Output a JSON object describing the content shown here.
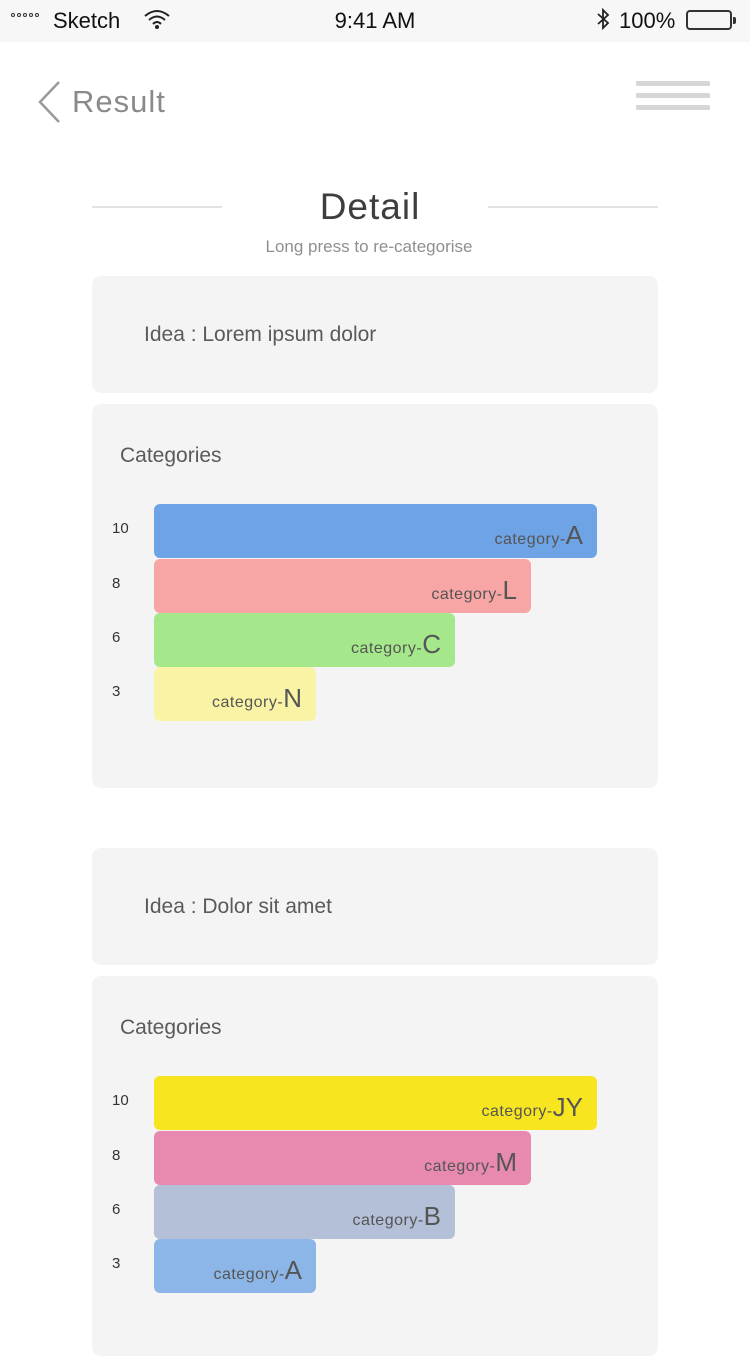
{
  "status_bar": {
    "carrier": "Sketch",
    "time": "9:41 AM",
    "battery": "100%",
    "icons": [
      "signal-icon",
      "wifi-icon",
      "bluetooth-icon",
      "battery-icon"
    ]
  },
  "nav": {
    "back_label": "Result",
    "back_icon": "chevron-left-icon",
    "menu_icon": "hamburger-menu-icon"
  },
  "header": {
    "title": "Detail",
    "subtitle": "Long press to re-categorise"
  },
  "ideas": [
    {
      "idea_text": "Idea : Lorem ipsum dolor",
      "categories_title": "Categories",
      "categories": [
        {
          "score": "10",
          "prefix": "category-",
          "code": "A",
          "value": 10,
          "color": "#6ea3e6"
        },
        {
          "score": "8",
          "prefix": "category-",
          "code": "L",
          "value": 8,
          "color": "#f8a5a5"
        },
        {
          "score": "6",
          "prefix": "category-",
          "code": "C",
          "value": 6,
          "color": "#a5e88b"
        },
        {
          "score": "3",
          "prefix": "category-",
          "code": "N",
          "value": 3,
          "color": "#f9f4a5"
        }
      ]
    },
    {
      "idea_text": "Idea : Dolor sit amet",
      "categories_title": "Categories",
      "categories": [
        {
          "score": "10",
          "prefix": "category-",
          "code": "JY",
          "value": 10,
          "color": "#f7e61f"
        },
        {
          "score": "8",
          "prefix": "category-",
          "code": "M",
          "value": 8,
          "color": "#e88aaf"
        },
        {
          "score": "6",
          "prefix": "category-",
          "code": "B",
          "value": 6,
          "color": "#b3c0d8"
        },
        {
          "score": "3",
          "prefix": "category-",
          "code": "A",
          "value": 3,
          "color": "#8db6e8"
        }
      ]
    }
  ]
}
